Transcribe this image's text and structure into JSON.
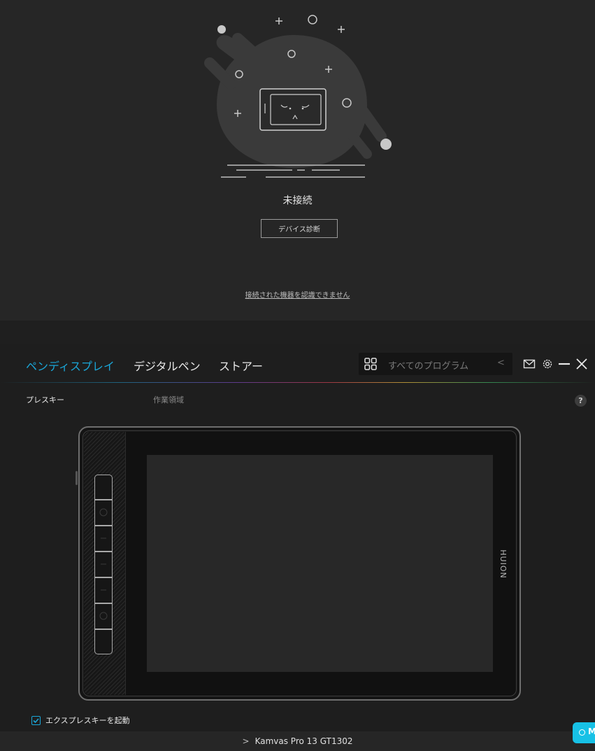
{
  "top_panel": {
    "status": "未接続",
    "diagnose_button": "デバイス診断",
    "help_link": "接続された機器を認識できません"
  },
  "nav": {
    "tabs": [
      {
        "label": "ペンディスプレイ",
        "active": true
      },
      {
        "label": "デジタルペン",
        "active": false
      },
      {
        "label": "ストアー",
        "active": false
      }
    ],
    "program_select": {
      "label": "すべてのプログラム",
      "icon": "grid-icon"
    },
    "window_icons": [
      "mail-icon",
      "gear-icon",
      "minimize-icon",
      "close-icon"
    ]
  },
  "subtabs": [
    {
      "label": "プレスキー",
      "active": true
    },
    {
      "label": "作業領域",
      "active": false
    }
  ],
  "help_icon": "?",
  "tablet": {
    "brand": "HUION",
    "press_key_count": 7
  },
  "checkbox": {
    "label": "エクスプレスキーを起動",
    "checked": true
  },
  "footer": {
    "device_name": "Kamvas Pro 13 GT1302"
  },
  "float_button": {
    "label": "M"
  },
  "colors": {
    "accent": "#1aa7d9",
    "float_button": "#17c1e6",
    "background": "#1e1e1e",
    "top_background": "#262626"
  }
}
